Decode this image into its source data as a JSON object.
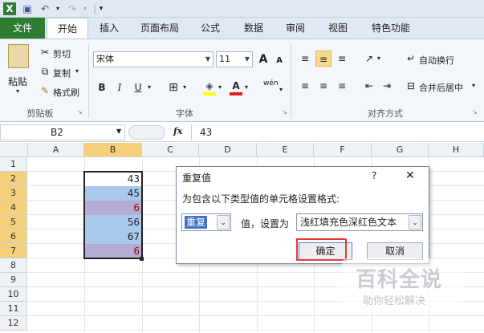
{
  "quick_access": {
    "undo_sep": "|",
    "dropdown": "▾"
  },
  "tabs": [
    "文件",
    "开始",
    "插入",
    "页面布局",
    "公式",
    "数据",
    "审阅",
    "视图",
    "特色功能"
  ],
  "clipboard": {
    "paste": "粘贴",
    "cut": "剪切",
    "copy": "复制",
    "format_painter": "格式刷",
    "group_label": "剪贴板"
  },
  "font": {
    "name": "宋体",
    "size": "11",
    "grow": "A",
    "shrink": "A",
    "bold": "B",
    "italic": "I",
    "underline": "U",
    "phonetic": "wén",
    "group_label": "字体"
  },
  "alignment": {
    "wrap_text": "自动换行",
    "merge_center": "合并后居中",
    "group_label": "对齐方式"
  },
  "formula_bar": {
    "name_box": "B2",
    "fx": "fx",
    "value": "43"
  },
  "columns": [
    "A",
    "B",
    "C",
    "D",
    "E",
    "F",
    "G",
    "H"
  ],
  "rows": [
    "1",
    "2",
    "3",
    "4",
    "5",
    "6",
    "7",
    "8",
    "9",
    "10",
    "11",
    "12"
  ],
  "cells_b": [
    {
      "row": "2",
      "value": "43",
      "fill": "#ffffff",
      "color": "#222222"
    },
    {
      "row": "3",
      "value": "45",
      "fill": "#a9c9ec",
      "color": "#222222"
    },
    {
      "row": "4",
      "value": "6",
      "fill": "#b5acd3",
      "color": "#9c0006"
    },
    {
      "row": "5",
      "value": "56",
      "fill": "#a9c9ec",
      "color": "#222222"
    },
    {
      "row": "6",
      "value": "67",
      "fill": "#a9c9ec",
      "color": "#222222"
    },
    {
      "row": "7",
      "value": "6",
      "fill": "#b5acd3",
      "color": "#9c0006"
    }
  ],
  "dialog": {
    "title": "重复值",
    "help": "?",
    "close": "✕",
    "prompt": "为包含以下类型值的单元格设置格式:",
    "type_value": "重复",
    "middle_label": "值，设置为",
    "format_value": "浅红填充色深红色文本",
    "ok": "确定",
    "cancel": "取消"
  },
  "watermark": {
    "title": "百科全说",
    "subtitle": "助你轻松解决"
  },
  "colors": {
    "file_tab": "#2e7d32",
    "selection_header": "#f5cf7a",
    "highlight_box": "#e53935"
  }
}
